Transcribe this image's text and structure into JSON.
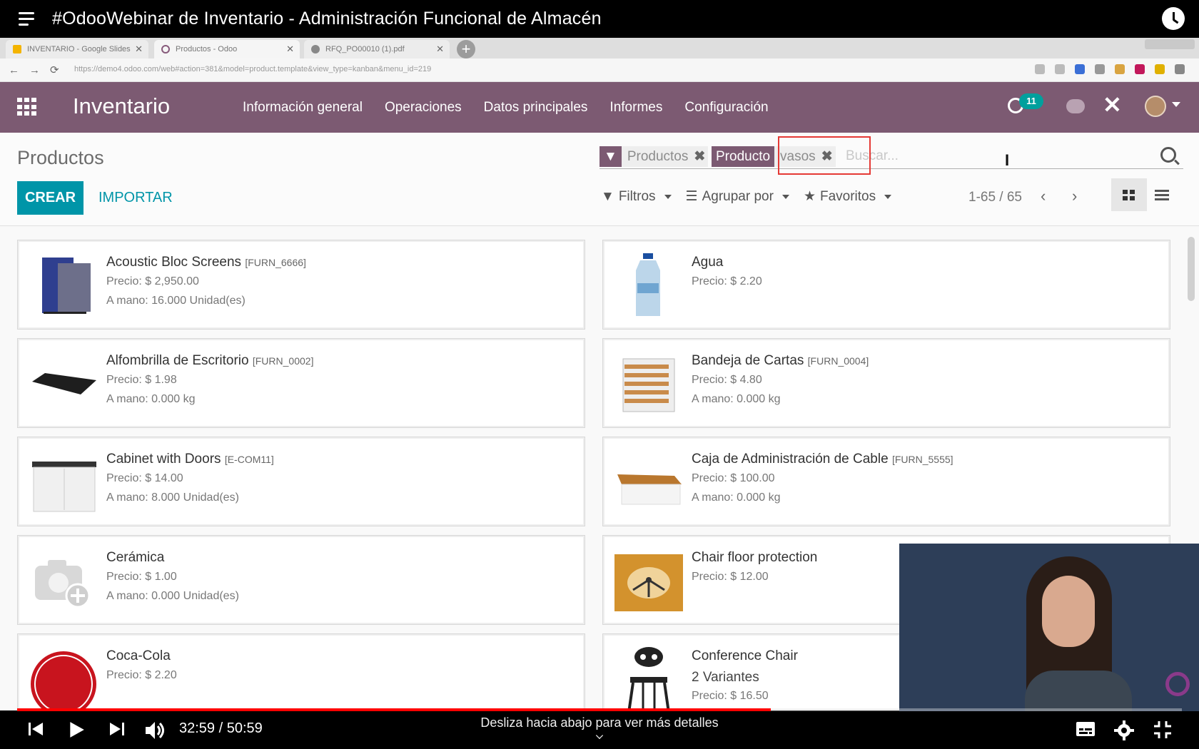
{
  "video": {
    "title": "#OdooWebinar de Inventario - Administración Funcional de Almacén",
    "time_current": "32:59",
    "time_total": "50:59",
    "time_display": "32:59 / 50:59",
    "progress_fraction": 0.647,
    "hint": "Desliza hacia abajo para ver más detalles"
  },
  "browser": {
    "tabs": [
      {
        "label": "INVENTARIO - Google Slides",
        "favicon_color": "#f4b400"
      },
      {
        "label": "Productos - Odoo",
        "favicon_color": "#875a7b"
      },
      {
        "label": "RFQ_PO00010 (1).pdf",
        "favicon_color": "#888888"
      }
    ],
    "url": "https://demo4.odoo.com/web#action=381&model=product.template&view_type=kanban&menu_id=219"
  },
  "odoo": {
    "app_name": "Inventario",
    "menu": [
      "Información general",
      "Operaciones",
      "Datos principales",
      "Informes",
      "Configuración"
    ],
    "activity_count": "11",
    "breadcrumb": "Productos",
    "create_label": "CREAR",
    "import_label": "IMPORTAR",
    "facets": [
      {
        "label": "Productos",
        "type": "filter"
      },
      {
        "label": "Producto",
        "value": "vasos",
        "type": "field"
      }
    ],
    "search_placeholder": "Buscar...",
    "filters_label": "Filtros",
    "groupby_label": "Agrupar por",
    "favorites_label": "Favoritos",
    "pager": "1-65 / 65",
    "accent": "#7c5a72",
    "primary": "#0095a8"
  },
  "products": [
    {
      "name": "Acoustic Bloc Screens",
      "code": "[FURN_6666]",
      "price": "Precio: $ 2,950.00",
      "onhand": "A mano: 16.000 Unidad(es)",
      "icon": "screens-image"
    },
    {
      "name": "Agua",
      "code": "",
      "price": "Precio: $ 2.20",
      "onhand": "",
      "icon": "water-bottle-image"
    },
    {
      "name": "Alfombrilla de Escritorio",
      "code": "[FURN_0002]",
      "price": "Precio: $ 1.98",
      "onhand": "A mano: 0.000 kg",
      "icon": "desk-pad-image"
    },
    {
      "name": "Bandeja de Cartas",
      "code": "[FURN_0004]",
      "price": "Precio: $ 4.80",
      "onhand": "A mano: 0.000 kg",
      "icon": "letter-tray-image"
    },
    {
      "name": "Cabinet with Doors",
      "code": "[E-COM11]",
      "price": "Precio: $ 14.00",
      "onhand": "A mano: 8.000 Unidad(es)",
      "icon": "cabinet-image"
    },
    {
      "name": "Caja de Administración de Cable",
      "code": "[FURN_5555]",
      "price": "Precio: $ 100.00",
      "onhand": "A mano: 0.000 kg",
      "icon": "cable-box-image"
    },
    {
      "name": "Cerámica",
      "code": "",
      "price": "Precio: $ 1.00",
      "onhand": "A mano: 0.000 Unidad(es)",
      "icon": "camera-placeholder-icon"
    },
    {
      "name": "Chair floor protection",
      "code": "",
      "price": "Precio: $ 12.00",
      "onhand": "",
      "icon": "floor-protection-image"
    },
    {
      "name": "Coca-Cola",
      "code": "",
      "price": "Precio: $ 2.20",
      "onhand": "",
      "icon": "coca-cola-image"
    },
    {
      "name": "Conference Chair",
      "code": "",
      "variants": "2 Variantes",
      "price": "Precio: $ 16.50",
      "onhand": "",
      "icon": "chair-image"
    }
  ]
}
